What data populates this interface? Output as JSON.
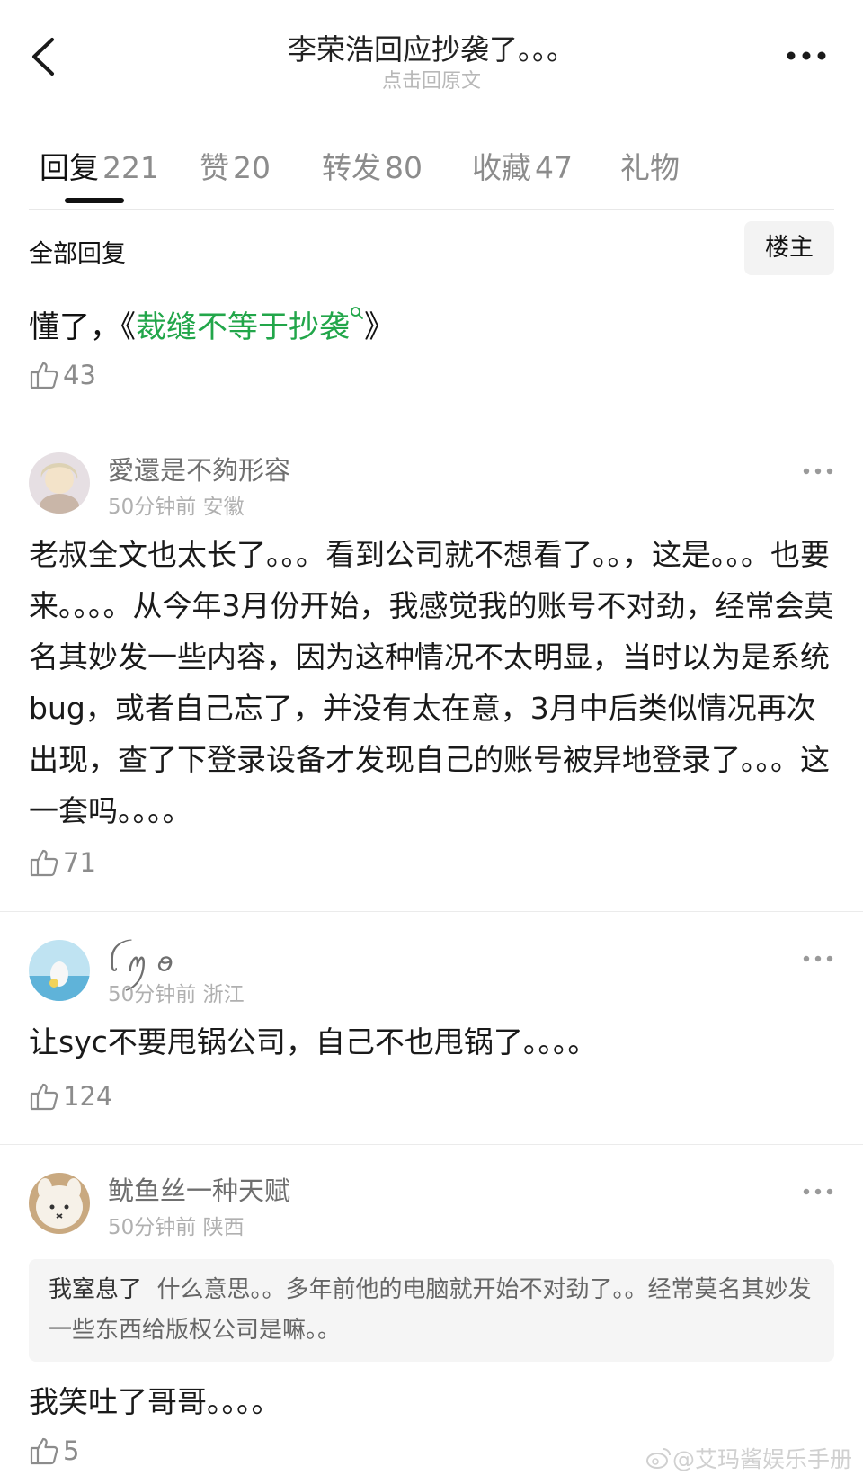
{
  "header": {
    "title": "李荣浩回应抄袭了。。。",
    "subtitle": "点击回原文"
  },
  "tabs": [
    {
      "label": "回复",
      "count": "221"
    },
    {
      "label": "赞",
      "count": "20"
    },
    {
      "label": "转发",
      "count": "80"
    },
    {
      "label": "收藏",
      "count": "47"
    },
    {
      "label": "礼物",
      "count": ""
    }
  ],
  "section": {
    "title": "全部回复",
    "filter_button": "楼主"
  },
  "op_comment": {
    "prefix": "懂了，《",
    "link": "裁缝不等于抄袭",
    "suffix": "》",
    "likes": "43"
  },
  "comments": [
    {
      "username": "愛還是不夠形容",
      "time": "50分钟前",
      "location": "安徽",
      "text": "老叔全文也太长了。。。看到公司就不想看了。。，这是。。。也要来。。。。从今年3月份开始，我感觉我的账号不对劲，经常会莫名其妙发一些内容，因为这种情况不太明显，当时以为是系统bug，或者自己忘了，并没有太在意，3月中后类似情况再次出现，查了下登录设备才发现自己的账号被异地登录了。。。这一套吗。。。。",
      "likes": "71"
    },
    {
      "username": "ꪶ ꪑ ꪮ",
      "time": "50分钟前",
      "location": "浙江",
      "text": "让syc不要甩锅公司，自己不也甩锅了。。。。",
      "likes": "124"
    },
    {
      "username": "鱿鱼丝一种天赋",
      "time": "50分钟前",
      "location": "陕西",
      "quote_name": "我窒息了",
      "quote_text": "什么意思。。多年前他的电脑就开始不对劲了。。经常莫名其妙发一些东西给版权公司是嘛。。",
      "text": "我笑吐了哥哥。。。。",
      "likes": "5"
    }
  ],
  "watermark": "@艾玛酱娱乐手册",
  "colors": {
    "link_green": "#22a64a",
    "muted": "#8c8c8c"
  },
  "icons": [
    "back-icon",
    "more-icon",
    "search-icon",
    "thumb-up-icon",
    "weibo-icon"
  ]
}
